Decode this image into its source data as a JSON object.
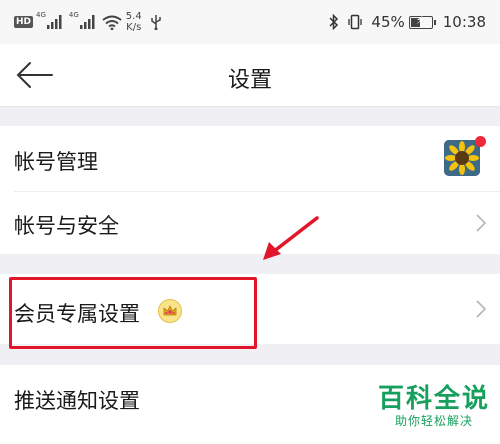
{
  "status_bar": {
    "hd_badge": "HD",
    "network_1": "4G",
    "network_2": "4G",
    "speed_value": "5.4",
    "speed_unit": "K/s",
    "battery_percent": "45%",
    "battery_level": 0.45,
    "time": "10:38",
    "icons": [
      "signal-icon",
      "wifi-icon",
      "usb-icon",
      "bluetooth-icon",
      "vibrate-icon",
      "battery-icon"
    ]
  },
  "nav": {
    "title": "设置"
  },
  "rows": [
    {
      "label": "帐号管理"
    },
    {
      "label": "帐号与安全"
    },
    {
      "label": "会员专属设置"
    },
    {
      "label": "推送通知设置"
    }
  ],
  "watermark": {
    "brand": "百科全说",
    "tagline": "助你轻松解决"
  },
  "colors": {
    "accent_red": "#e2152b",
    "notification_dot": "#f0283c",
    "watermark_green": "#17a05d",
    "section_gap": "#efeff4"
  }
}
